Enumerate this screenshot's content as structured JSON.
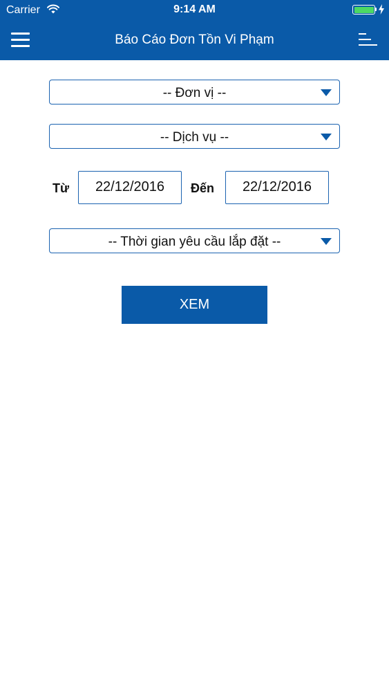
{
  "status_bar": {
    "carrier": "Carrier",
    "time": "9:14 AM"
  },
  "nav": {
    "title": "Báo Cáo Đơn Tồn Vi Phạm",
    "left_icon": "menu-icon",
    "right_icon": "list-icon"
  },
  "form": {
    "unit_select": "-- Đơn vị --",
    "service_select": "-- Dịch vụ --",
    "from_label": "Từ",
    "from_date": "22/12/2016",
    "to_label": "Đến",
    "to_date": "22/12/2016",
    "install_time_select": "-- Thời gian yêu cầu lắp đặt --",
    "view_button": "XEM"
  },
  "colors": {
    "primary": "#0a5aa8",
    "battery": "#4cd964",
    "border": "#1a62b0"
  }
}
